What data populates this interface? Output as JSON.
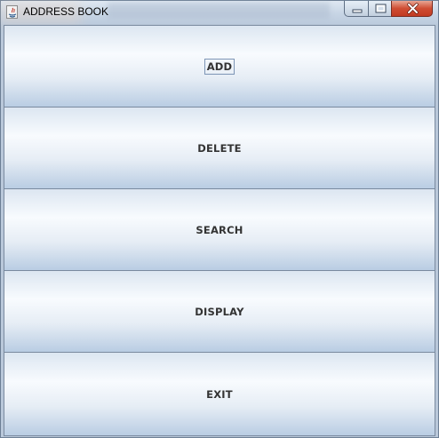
{
  "window": {
    "title": "ADDRESS BOOK",
    "app_icon": "java-icon",
    "controls": {
      "minimize": "minimize-icon",
      "maximize": "maximize-icon",
      "close": "close-icon"
    }
  },
  "buttons": [
    {
      "label": "ADD",
      "focused": true
    },
    {
      "label": "DELETE",
      "focused": false
    },
    {
      "label": "SEARCH",
      "focused": false
    },
    {
      "label": "DISPLAY",
      "focused": false
    },
    {
      "label": "EXIT",
      "focused": false
    }
  ]
}
